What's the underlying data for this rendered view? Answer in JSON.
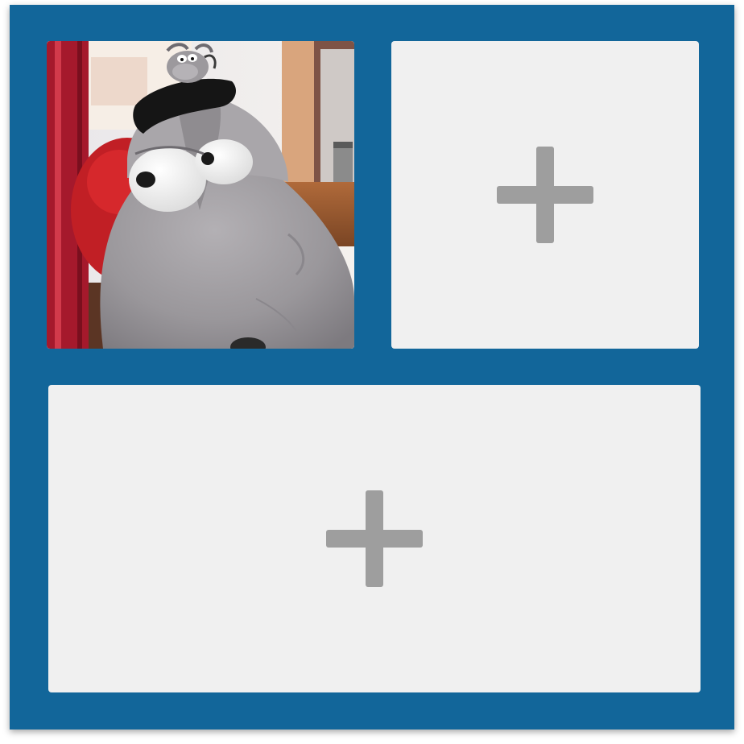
{
  "colors": {
    "frame": "#12669a",
    "cell_background": "#f0f0f0",
    "plus_icon": "#9e9e9e"
  },
  "cells": [
    {
      "name": "photo-cell",
      "state": "filled",
      "content": "photo"
    },
    {
      "name": "empty-cell-top-right",
      "state": "empty",
      "icon": "plus-icon"
    },
    {
      "name": "empty-cell-bottom",
      "state": "empty",
      "icon": "plus-icon"
    }
  ]
}
